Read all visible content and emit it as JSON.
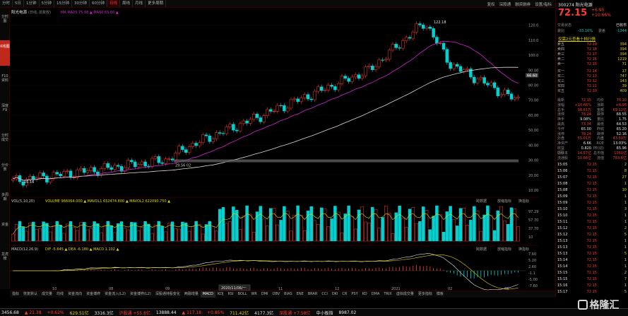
{
  "topbar": {
    "tabs": [
      "分时",
      "5日",
      "1分钟",
      "5分钟",
      "15分钟",
      "30分钟",
      "60分钟",
      "日线",
      "周线",
      "月线",
      "更多周期"
    ],
    "active_tab": "日线",
    "right": [
      "复权",
      "深股通",
      "融资融券",
      "设置/指标"
    ]
  },
  "leftbar": {
    "items": [
      "分时图",
      "K线图",
      "F10资料",
      "深度F9",
      "分时成交",
      "分价表",
      "多周期",
      "资金",
      "龙虎榜"
    ],
    "active": "K线图"
  },
  "chart": {
    "stock_label": "阳光电源",
    "ma_label": "(日线, 前复权)",
    "ma_values": "MA  MA20 75.08  ▲  MA60 65.60  ▲",
    "price_axis": [
      "120.00",
      "110.00",
      "100.00",
      "90.00",
      "80.00",
      "70.00",
      "60.00",
      "50.00",
      "40.00",
      "30.00",
      "20.00",
      "10.00"
    ],
    "current_price_tag": "66.60",
    "high_label": "122.18",
    "low_label": "16.16",
    "support_label": "29.56 02",
    "vol_label": "VOL(5,10,20)",
    "vol_values": "VOLUME 966064.000  ▲  MAVOL1 652474.800  ▲  MAVOL2 622090.750  ▲",
    "vol_axis": [
      "97.29",
      "57.70",
      "37.70",
      "10"
    ],
    "vol_right": [
      "跨数据",
      "放缩指标",
      "换指标"
    ],
    "macd_label": "MACD(12,26,9)",
    "macd_values": "DIF -5.645  ▲  DEA -6.180  ▲  MACD 1.102  ▲",
    "macd_axis": [
      "7.60",
      "5.20",
      "2.60",
      "-1.1",
      "-5.00",
      "-7.60"
    ],
    "macd_right": [
      "跨数据",
      "放缩指标",
      "换指标"
    ],
    "x_axis": [
      "10",
      "08",
      "09",
      "10",
      "11",
      "12",
      "2021",
      "02",
      "03"
    ],
    "date_box": "2020/11/06/一"
  },
  "chart_data": {
    "type": "candlestick",
    "title": "阳光电源",
    "ylim": [
      10,
      125
    ],
    "ma_series": [
      "MA20",
      "MA60"
    ],
    "ohlc_close_sample": [
      16.16,
      17,
      18,
      19,
      20,
      21,
      22,
      23,
      24,
      26,
      28,
      30,
      36,
      40,
      42,
      44,
      48,
      52,
      56,
      60,
      66,
      72,
      80,
      90,
      98,
      105,
      112,
      122.18,
      100,
      92,
      85,
      80,
      78,
      72.15
    ]
  },
  "rpanel": {
    "code": "300274",
    "name": "阳光电源",
    "price": "72.15",
    "change": "+6.95",
    "pct": "+10.66%",
    "status_label": "交易状态",
    "status_value": "已收市",
    "weibi_label": "委比",
    "weibi": "-33.16%",
    "weicha_label": "委差",
    "weicha": "-1344",
    "related": "仅需2元查看十档行情",
    "asks": [
      {
        "l": "卖五",
        "p": "72.19",
        "v": "394"
      },
      {
        "l": "卖四",
        "p": "72.18",
        "v": "394"
      },
      {
        "l": "卖三",
        "p": "72.17",
        "v": "394"
      },
      {
        "l": "卖二",
        "p": "72.16",
        "v": "1219"
      },
      {
        "l": "卖一",
        "p": "72.15",
        "v": "71"
      }
    ],
    "bids": [
      {
        "l": "买一",
        "p": "72.14",
        "v": "17"
      },
      {
        "l": "买二",
        "p": "72.13",
        "v": "747"
      },
      {
        "l": "买三",
        "p": "72.12",
        "v": "143"
      },
      {
        "l": "买四",
        "p": "72.11",
        "v": "39"
      },
      {
        "l": "买五",
        "p": "72.10",
        "v": "409"
      }
    ],
    "stats": [
      {
        "a": "最新",
        "b": "72.15",
        "c": "均价",
        "d": "70.10"
      },
      {
        "a": "涨幅",
        "b": "+10.66%",
        "c": "涨跌",
        "d": "+6.95"
      },
      {
        "a": "总手",
        "b": "98.61万",
        "c": "金额",
        "d": "69.12亿"
      },
      {
        "a": "涨停",
        "b": "78.24",
        "c": "跌停",
        "d": "68.55"
      },
      {
        "a": "换手",
        "b": "9.08%",
        "c": "量比",
        "d": "1.75"
      },
      {
        "a": "最高",
        "b": "73.34",
        "c": "最低",
        "d": "64.53"
      },
      {
        "a": "今开",
        "b": "65.00",
        "c": "昨收",
        "d": "65.20"
      },
      {
        "a": "涨停",
        "b": "78.24",
        "c": "跌停",
        "d": "52.16"
      },
      {
        "a": "外盘",
        "b": "55.01万",
        "c": "内盘",
        "d": "43.59万"
      },
      {
        "a": "净资产",
        "b": "6.66",
        "c": "ROE",
        "d": "13.03%"
      },
      {
        "a": "收益(三)",
        "b": "0.820",
        "c": "PE(动)",
        "d": "65.96"
      },
      {
        "a": "总股本",
        "b": "14.57亿",
        "c": "总市值",
        "d": "1051亿"
      },
      {
        "a": "流通股",
        "b": "10.86亿",
        "c": "流值",
        "d": "783.6亿"
      }
    ],
    "ticks": [
      {
        "t": "15:05",
        "p": "72.15",
        "v": "2"
      },
      {
        "t": "15:06",
        "p": "72.15",
        "v": "8"
      },
      {
        "t": "15:07",
        "p": "72.15",
        "v": "27"
      },
      {
        "t": "15:08",
        "p": "72.15",
        "v": "1"
      },
      {
        "t": "15:08",
        "p": "72.15",
        "v": "10"
      },
      {
        "t": "15:09",
        "p": "72.15",
        "v": "1"
      },
      {
        "t": "15:09",
        "p": "72.15",
        "v": "1"
      },
      {
        "t": "15:10",
        "p": "72.15",
        "v": "3"
      },
      {
        "t": "15:10",
        "p": "72.15",
        "v": "1"
      },
      {
        "t": "15:11",
        "p": "72.15",
        "v": "1"
      },
      {
        "t": "15:12",
        "p": "72.15",
        "v": "2"
      },
      {
        "t": "15:12",
        "p": "72.15",
        "v": "5"
      },
      {
        "t": "15:13",
        "p": "72.15",
        "v": "1"
      },
      {
        "t": "15:13",
        "p": "72.15",
        "v": "1"
      },
      {
        "t": "15:13",
        "p": "72.15",
        "v": "5"
      },
      {
        "t": "15:14",
        "p": "72.15",
        "v": "1"
      },
      {
        "t": "15:14",
        "p": "72.15",
        "v": "1"
      },
      {
        "t": "15:15",
        "p": "72.15",
        "v": "2"
      },
      {
        "t": "15:15",
        "p": "72.15",
        "v": "7"
      },
      {
        "t": "15:16",
        "p": "72.15",
        "v": "1"
      },
      {
        "t": "15:17",
        "p": "72.15",
        "v": "5"
      }
    ]
  },
  "btabs": [
    "指标",
    "恢复默认",
    "成交量",
    "均线",
    "资金流向",
    "资金博弈",
    "资金流入(L2)",
    "资金博弈(L2)",
    "深股通持股变化",
    "两融增量",
    "MACD",
    "KDJ",
    "RSI",
    "BOLL",
    "WR",
    "DMI",
    "OBV",
    "BIAS",
    "ENE",
    "BRAR",
    "CCI",
    "DKI",
    "CR",
    "PSY",
    "KD",
    "DMA",
    "TRIX",
    "虚拟成交量",
    "更多指标",
    "模板"
  ],
  "btab_active": "MACD",
  "status": [
    {
      "t": "3456.68",
      "c": "white"
    },
    {
      "t": "▲ 21.38",
      "c": "red"
    },
    {
      "t": "+0.62%",
      "c": "red"
    },
    {
      "t": "629.51亿",
      "c": "yellow"
    },
    {
      "t": "3316.3亿",
      "c": "white"
    },
    {
      "t": "沪股通 +55.8亿",
      "c": "red"
    },
    {
      "t": "13888.44",
      "c": "white"
    },
    {
      "t": "▲ 117.18",
      "c": "red"
    },
    {
      "t": "+0.85%",
      "c": "red"
    },
    {
      "t": "711.42亿",
      "c": "yellow"
    },
    {
      "t": "4177.3亿",
      "c": "white"
    },
    {
      "t": "深股通 +7.58亿",
      "c": "red"
    },
    {
      "t": "中小板指",
      "c": "white"
    },
    {
      "t": "8987.02",
      "c": "white"
    }
  ],
  "logo_text": "格隆汇",
  "colors": {
    "up": "#ff3b30",
    "down": "#00d2d2",
    "ma20": "#d026d0",
    "ma60": "#d8d8d8",
    "grid": "#3a0000",
    "vol_up": "#ff3b30",
    "vol_down": "#00d2d2"
  }
}
